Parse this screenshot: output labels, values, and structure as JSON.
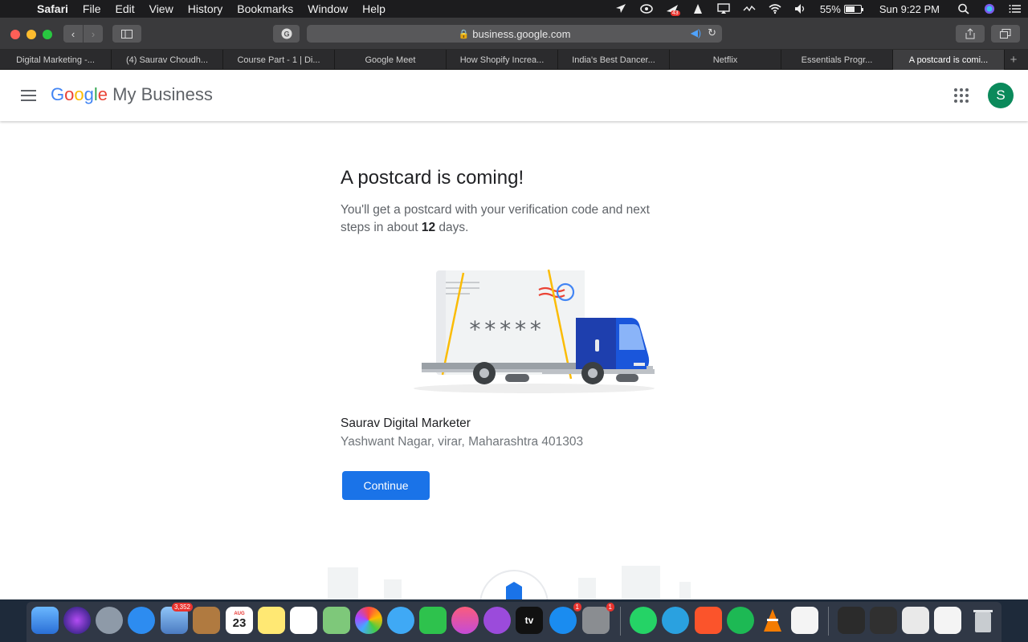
{
  "menubar": {
    "app_name": "Safari",
    "menus": [
      "File",
      "Edit",
      "View",
      "History",
      "Bookmarks",
      "Window",
      "Help"
    ],
    "battery": "55%",
    "clock": "Sun 9:22 PM",
    "badge_count": "43"
  },
  "browser": {
    "url": "business.google.com",
    "tabs": [
      "Digital Marketing -...",
      "(4) Saurav Choudh...",
      "Course Part - 1 | Di...",
      "Google Meet",
      "How Shopify Increa...",
      "India's Best Dancer...",
      "Netflix",
      "Essentials Progr...",
      "A postcard is comi..."
    ]
  },
  "header": {
    "logo_google": "Google",
    "logo_product": "My Business",
    "avatar_letter": "S"
  },
  "main": {
    "title": "A postcard is coming!",
    "desc_before": "You'll get a postcard with your verification code and next steps in about",
    "desc_days": "12",
    "desc_after": "days.",
    "code_mask": "*****",
    "business_name": "Saurav Digital Marketer",
    "business_address": "Yashwant Nagar, virar, Maharashtra 401303",
    "continue_label": "Continue"
  },
  "dock": {
    "mail_badge": "3,352",
    "calendar_month": "AUG",
    "calendar_day": "23",
    "appstore_badge": "1",
    "prefs_badge": "1",
    "tv_label": "tv"
  },
  "colors": {
    "primary_button": "#1a73e8",
    "avatar_bg": "#0b8a5b",
    "google_blue": "#4285f4",
    "google_red": "#ea4335",
    "google_yellow": "#fbbc05",
    "google_green": "#34a853"
  }
}
